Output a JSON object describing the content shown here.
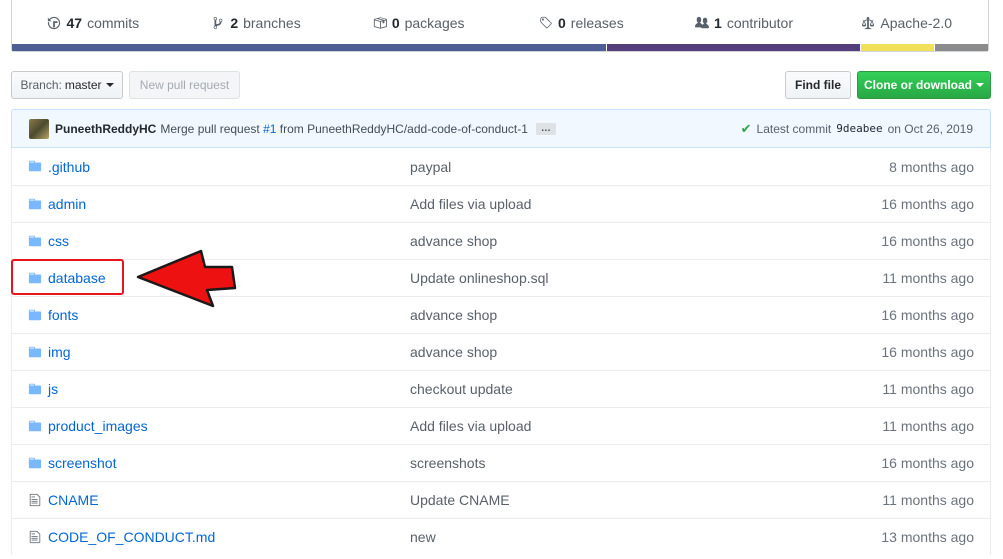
{
  "summary": {
    "commits": {
      "count": "47",
      "label": "commits"
    },
    "branches": {
      "count": "2",
      "label": "branches"
    },
    "packages": {
      "count": "0",
      "label": "packages"
    },
    "releases": {
      "count": "0",
      "label": "releases"
    },
    "contributors": {
      "count": "1",
      "label": "contributor"
    },
    "license": {
      "label": "Apache-2.0"
    }
  },
  "language_bar_colors": [
    "#4f5d95",
    "#563d7c",
    "#f1e05a",
    "#8c8c8c"
  ],
  "toolbar": {
    "branch_prefix": "Branch:",
    "branch_name": "master",
    "new_pr_label": "New pull request",
    "find_file_label": "Find file",
    "clone_label": "Clone or download"
  },
  "commit": {
    "author": "PuneethReddyHC",
    "message_prefix": "Merge pull request",
    "pr_number": "#1",
    "message_suffix": "from PuneethReddyHC/add-code-of-conduct-1",
    "ellipsis": "…",
    "latest_label": "Latest commit",
    "sha": "9deabee",
    "date": "on Oct 26, 2019"
  },
  "files": [
    {
      "type": "folder",
      "name": ".github",
      "message": "paypal",
      "age": "8 months ago"
    },
    {
      "type": "folder",
      "name": "admin",
      "message": "Add files via upload",
      "age": "16 months ago"
    },
    {
      "type": "folder",
      "name": "css",
      "message": "advance shop",
      "age": "16 months ago"
    },
    {
      "type": "folder",
      "name": "database",
      "message": "Update onlineshop.sql",
      "age": "11 months ago"
    },
    {
      "type": "folder",
      "name": "fonts",
      "message": "advance shop",
      "age": "16 months ago"
    },
    {
      "type": "folder",
      "name": "img",
      "message": "advance shop",
      "age": "16 months ago"
    },
    {
      "type": "folder",
      "name": "js",
      "message": "checkout update",
      "age": "11 months ago"
    },
    {
      "type": "folder",
      "name": "product_images",
      "message": "Add files via upload",
      "age": "11 months ago"
    },
    {
      "type": "folder",
      "name": "screenshot",
      "message": "screenshots",
      "age": "16 months ago"
    },
    {
      "type": "file",
      "name": "CNAME",
      "message": "Update CNAME",
      "age": "11 months ago"
    },
    {
      "type": "file",
      "name": "CODE_OF_CONDUCT.md",
      "message": "new",
      "age": "13 months ago"
    }
  ],
  "icons": {
    "folder": "folder-icon",
    "file": "file-icon",
    "commits": "history-icon",
    "branches": "git-branch-icon",
    "packages": "package-icon",
    "releases": "tag-icon",
    "contributors": "people-icon",
    "license": "law-icon"
  },
  "colors": {
    "link": "#0366d6",
    "clone_button": "#28a745",
    "highlight": "#e8141e"
  }
}
